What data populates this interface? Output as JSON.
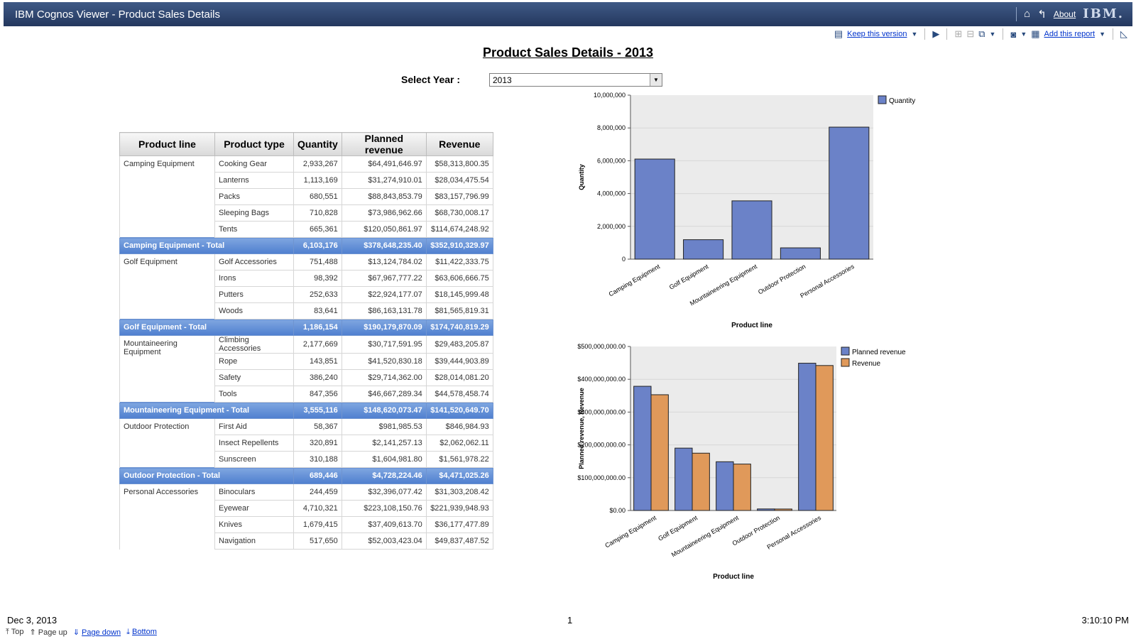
{
  "app": {
    "title": "IBM Cognos Viewer - Product Sales Details",
    "about": "About",
    "logo": "IBM."
  },
  "toolbar": {
    "keep_version": "Keep this version",
    "add_report": "Add this report"
  },
  "report": {
    "title": "Product Sales Details - 2013",
    "select_label": "Select Year :",
    "selected_year": "2013"
  },
  "table": {
    "headers": [
      "Product line",
      "Product type",
      "Quantity",
      "Planned revenue",
      "Revenue"
    ],
    "groups": [
      {
        "line": "Camping Equipment",
        "rows": [
          [
            "Cooking Gear",
            "2,933,267",
            "$64,491,646.97",
            "$58,313,800.35"
          ],
          [
            "Lanterns",
            "1,113,169",
            "$31,274,910.01",
            "$28,034,475.54"
          ],
          [
            "Packs",
            "680,551",
            "$88,843,853.79",
            "$83,157,796.99"
          ],
          [
            "Sleeping Bags",
            "710,828",
            "$73,986,962.66",
            "$68,730,008.17"
          ],
          [
            "Tents",
            "665,361",
            "$120,050,861.97",
            "$114,674,248.92"
          ]
        ],
        "total": [
          "Camping Equipment - Total",
          "6,103,176",
          "$378,648,235.40",
          "$352,910,329.97"
        ]
      },
      {
        "line": "Golf Equipment",
        "rows": [
          [
            "Golf Accessories",
            "751,488",
            "$13,124,784.02",
            "$11,422,333.75"
          ],
          [
            "Irons",
            "98,392",
            "$67,967,777.22",
            "$63,606,666.75"
          ],
          [
            "Putters",
            "252,633",
            "$22,924,177.07",
            "$18,145,999.48"
          ],
          [
            "Woods",
            "83,641",
            "$86,163,131.78",
            "$81,565,819.31"
          ]
        ],
        "total": [
          "Golf Equipment - Total",
          "1,186,154",
          "$190,179,870.09",
          "$174,740,819.29"
        ]
      },
      {
        "line": "Mountaineering Equipment",
        "rows": [
          [
            "Climbing Accessories",
            "2,177,669",
            "$30,717,591.95",
            "$29,483,205.87"
          ],
          [
            "Rope",
            "143,851",
            "$41,520,830.18",
            "$39,444,903.89"
          ],
          [
            "Safety",
            "386,240",
            "$29,714,362.00",
            "$28,014,081.20"
          ],
          [
            "Tools",
            "847,356",
            "$46,667,289.34",
            "$44,578,458.74"
          ]
        ],
        "total": [
          "Mountaineering Equipment - Total",
          "3,555,116",
          "$148,620,073.47",
          "$141,520,649.70"
        ]
      },
      {
        "line": "Outdoor Protection",
        "rows": [
          [
            "First Aid",
            "58,367",
            "$981,985.53",
            "$846,984.93"
          ],
          [
            "Insect Repellents",
            "320,891",
            "$2,141,257.13",
            "$2,062,062.11"
          ],
          [
            "Sunscreen",
            "310,188",
            "$1,604,981.80",
            "$1,561,978.22"
          ]
        ],
        "total": [
          "Outdoor Protection - Total",
          "689,446",
          "$4,728,224.46",
          "$4,471,025.26"
        ]
      },
      {
        "line": "Personal Accessories",
        "rows": [
          [
            "Binoculars",
            "244,459",
            "$32,396,077.42",
            "$31,303,208.42"
          ],
          [
            "Eyewear",
            "4,710,321",
            "$223,108,150.76",
            "$221,939,948.93"
          ],
          [
            "Knives",
            "1,679,415",
            "$37,409,613.70",
            "$36,177,477.89"
          ],
          [
            "Navigation",
            "517,650",
            "$52,003,423.04",
            "$49,837,487.52"
          ]
        ],
        "total": null
      }
    ]
  },
  "chart_data": [
    {
      "type": "bar",
      "categories": [
        "Camping Equipment",
        "Golf Equipment",
        "Mountaineering Equipment",
        "Outdoor Protection",
        "Personal Accessories"
      ],
      "series": [
        {
          "name": "Quantity",
          "values": [
            6103176,
            1186154,
            3555116,
            689446,
            8050000
          ]
        }
      ],
      "xlabel": "Product line",
      "ylabel": "Quantity",
      "ylim": [
        0,
        10000000
      ],
      "yticks": [
        "0",
        "2,000,000",
        "4,000,000",
        "6,000,000",
        "8,000,000",
        "10,000,000"
      ],
      "colors": [
        "#6b82c8"
      ],
      "legend": "top-right",
      "grid": true
    },
    {
      "type": "bar",
      "categories": [
        "Camping Equipment",
        "Golf Equipment",
        "Mountaineering Equipment",
        "Outdoor Protection",
        "Personal Accessories"
      ],
      "series": [
        {
          "name": "Planned revenue",
          "values": [
            378648235.4,
            190179870.09,
            148620073.47,
            4728224.46,
            449000000
          ]
        },
        {
          "name": "Revenue",
          "values": [
            352910329.97,
            174740819.29,
            141520649.7,
            4471025.26,
            442000000
          ]
        }
      ],
      "xlabel": "Product line",
      "ylabel": "Planned revenue, Revenue",
      "ylim": [
        0,
        500000000
      ],
      "yticks": [
        "$0.00",
        "$100,000,000.00",
        "$200,000,000.00",
        "$300,000,000.00",
        "$400,000,000.00",
        "$500,000,000.00"
      ],
      "colors": [
        "#6b82c8",
        "#e0995a"
      ],
      "legend": "top-right",
      "grid": true
    }
  ],
  "footer": {
    "date": "Dec 3, 2013",
    "page": "1",
    "time": "3:10:10 PM",
    "top": "Top",
    "page_up": "Page up",
    "page_down": "Page down",
    "bottom": "Bottom"
  }
}
